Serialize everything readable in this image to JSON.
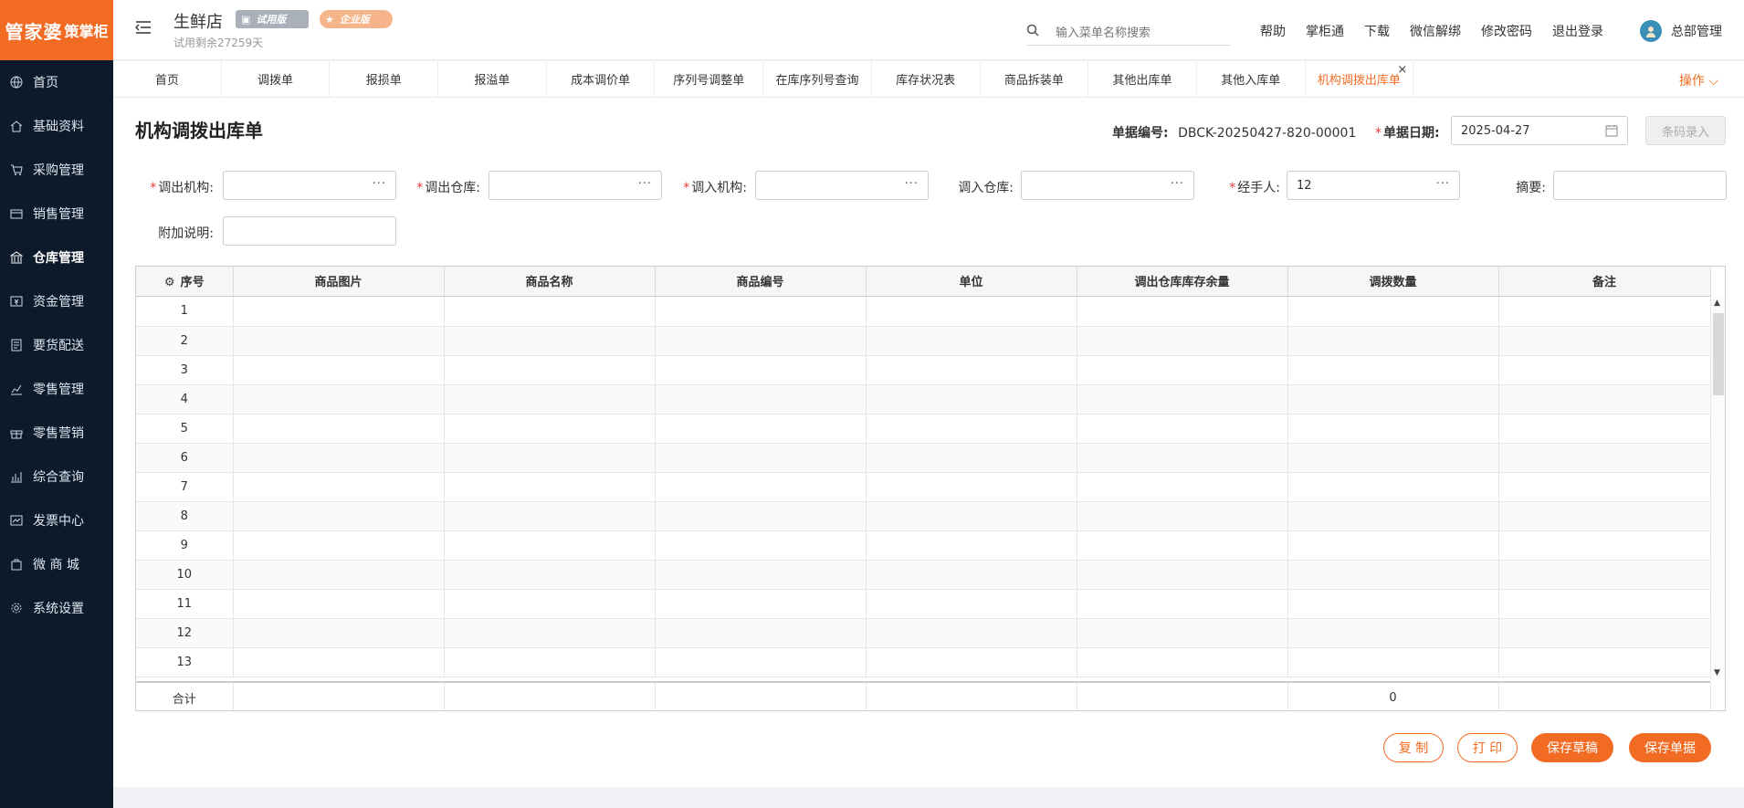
{
  "sidebar": {
    "logo": "管家婆",
    "logo_suffix": "策掌柜",
    "items": [
      {
        "label": "首页",
        "icon": "globe-icon"
      },
      {
        "label": "基础资料",
        "icon": "home-icon"
      },
      {
        "label": "采购管理",
        "icon": "cart-icon"
      },
      {
        "label": "销售管理",
        "icon": "card-icon"
      },
      {
        "label": "仓库管理",
        "icon": "warehouse-icon"
      },
      {
        "label": "资金管理",
        "icon": "money-icon"
      },
      {
        "label": "要货配送",
        "icon": "document-icon"
      },
      {
        "label": "零售管理",
        "icon": "chart-icon"
      },
      {
        "label": "零售营销",
        "icon": "gift-icon"
      },
      {
        "label": "综合查询",
        "icon": "bar-chart-icon"
      },
      {
        "label": "发票中心",
        "icon": "invoice-icon"
      },
      {
        "label": "微 商 城",
        "icon": "bag-icon"
      },
      {
        "label": "系统设置",
        "icon": "gear-icon"
      }
    ],
    "active": "仓库管理"
  },
  "header": {
    "shop_name": "生鲜店",
    "badge_trial": "试用版",
    "badge_enterprise": "企业版",
    "remaining": "试用剩余27259天",
    "search_placeholder": "输入菜单名称搜索",
    "links": [
      "帮助",
      "掌柜通",
      "下载",
      "微信解绑",
      "修改密码",
      "退出登录"
    ],
    "user": "总部管理"
  },
  "tabs": {
    "items": [
      "首页",
      "调拨单",
      "报损单",
      "报溢单",
      "成本调价单",
      "序列号调整单",
      "在库序列号查询",
      "库存状况表",
      "商品拆装单",
      "其他出库单",
      "其他入库单",
      "机构调拨出库单"
    ],
    "active_index": 11,
    "close": "×",
    "ops": "操作 ⌵"
  },
  "form": {
    "title": "机构调拨出库单",
    "doc_no_label": "单据编号:",
    "doc_no": "DBCK-20250427-820-00001",
    "date_label": "单据日期:",
    "date": "2025-04-27",
    "barcode_btn": "条码录入",
    "fields": {
      "out_org": {
        "label": "调出机构:",
        "value": ""
      },
      "out_wh": {
        "label": "调出仓库:",
        "value": ""
      },
      "in_org": {
        "label": "调入机构:",
        "value": ""
      },
      "in_wh": {
        "label": "调入仓库:",
        "value": ""
      },
      "handler": {
        "label": "经手人:",
        "value": "12"
      },
      "summary": {
        "label": "摘要:",
        "value": ""
      },
      "note": {
        "label": "附加说明:",
        "value": ""
      }
    }
  },
  "table": {
    "columns": [
      "序号",
      "商品图片",
      "商品名称",
      "商品编号",
      "单位",
      "调出仓库库存余量",
      "调拨数量",
      "备注"
    ],
    "rows": [
      "1",
      "2",
      "3",
      "4",
      "5",
      "6",
      "7",
      "8",
      "9",
      "10",
      "11",
      "12",
      "13"
    ],
    "total_label": "合计",
    "total_qty": "0"
  },
  "buttons": {
    "copy": "复 制",
    "print": "打 印",
    "save_draft": "保存草稿",
    "save_doc": "保存单据"
  },
  "colors": {
    "accent": "#f26b23",
    "sidebar": "#0c1a2b"
  }
}
